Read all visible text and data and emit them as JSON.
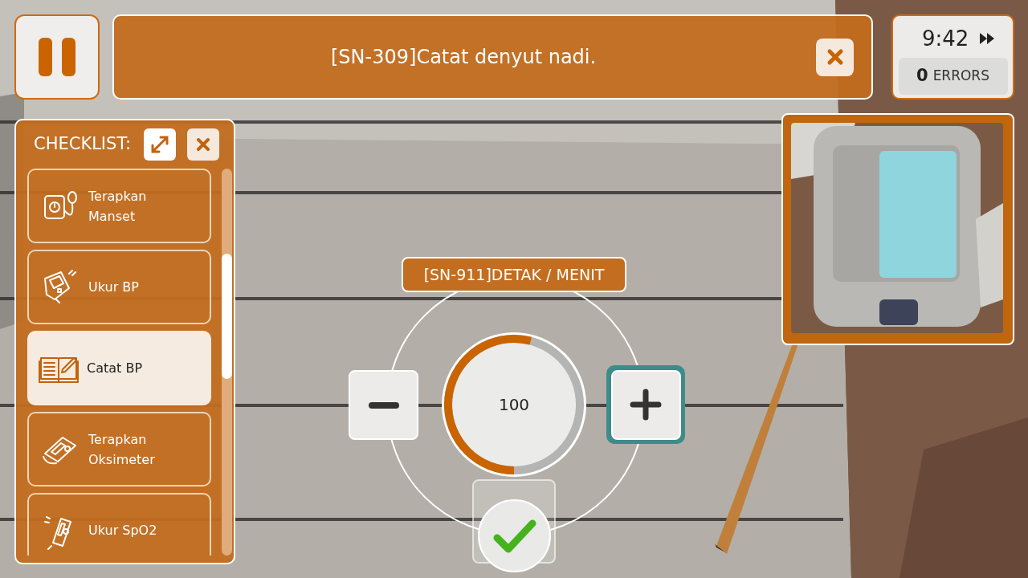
{
  "pause_button": {
    "kind": "pause"
  },
  "instruction": {
    "text": "[SN-309]Catat denyut nadi."
  },
  "timer": {
    "time": "9:42",
    "errors_count": "0",
    "errors_label": "ERRORS"
  },
  "checklist": {
    "title": "CHECKLIST:",
    "items": [
      {
        "label": "Terapkan Manset",
        "selected": false
      },
      {
        "label": "Ukur BP",
        "selected": false
      },
      {
        "label": "Catat BP",
        "selected": true
      },
      {
        "label": "Terapkan Oksimeter",
        "selected": false
      },
      {
        "label": "Ukur SpO2",
        "selected": false
      }
    ]
  },
  "dial": {
    "label": "[SN-911]DETAK / MENIT",
    "value": "100",
    "level": 0.54,
    "plus_focused": true
  }
}
